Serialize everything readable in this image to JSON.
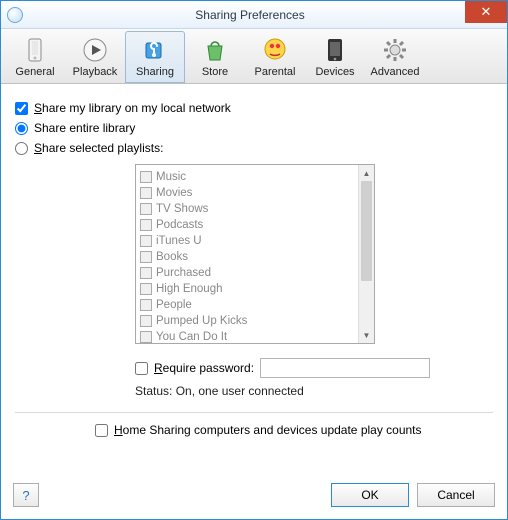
{
  "window": {
    "title": "Sharing Preferences",
    "close_label": "✕"
  },
  "tabs": {
    "general": "General",
    "playback": "Playback",
    "sharing": "Sharing",
    "store": "Store",
    "parental": "Parental",
    "devices": "Devices",
    "advanced": "Advanced"
  },
  "share": {
    "share_library": "Share my library on my local network",
    "share_entire": "Share entire library",
    "share_selected": "Share selected playlists:"
  },
  "playlists": [
    "Music",
    "Movies",
    "TV Shows",
    "Podcasts",
    "iTunes U",
    "Books",
    "Purchased",
    "High Enough",
    "People",
    "Pumped Up Kicks",
    "You Can Do It"
  ],
  "password": {
    "label": "Require password:",
    "value": ""
  },
  "status": "Status: On, one user connected",
  "home_sharing": "Home Sharing computers and devices update play counts",
  "buttons": {
    "help": "?",
    "ok": "OK",
    "cancel": "Cancel"
  }
}
